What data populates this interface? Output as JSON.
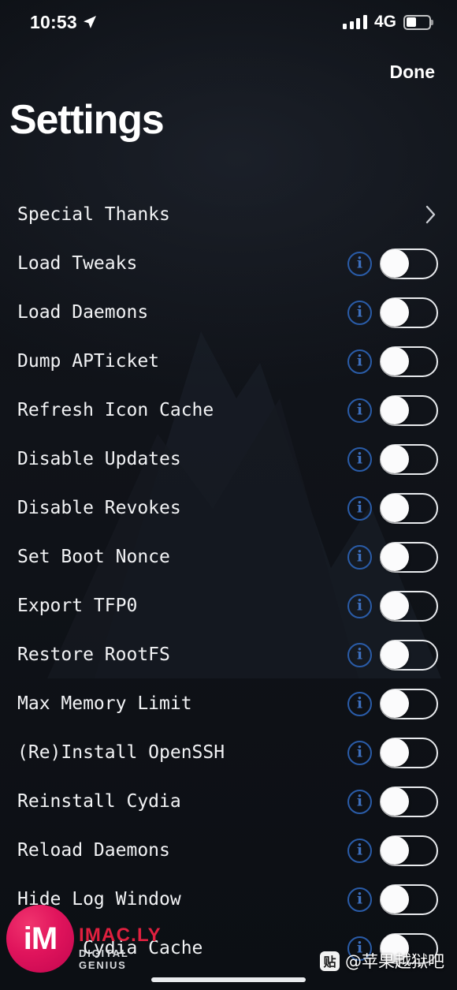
{
  "status_bar": {
    "time": "10:53",
    "location_icon": "location-arrow-icon",
    "signal_icon": "cellular-signal-icon",
    "signal_bars_filled": 4,
    "carrier": "4G",
    "battery_icon": "battery-icon",
    "battery_percent": 40
  },
  "nav": {
    "done_label": "Done"
  },
  "header": {
    "title": "Settings"
  },
  "list": {
    "rows": [
      {
        "label": "Special Thanks",
        "type": "disclosure",
        "accessory": "chevron-right-icon"
      },
      {
        "label": "Load Tweaks",
        "type": "toggle",
        "info": "i",
        "enabled": false
      },
      {
        "label": "Load Daemons",
        "type": "toggle",
        "info": "i",
        "enabled": false
      },
      {
        "label": "Dump APTicket",
        "type": "toggle",
        "info": "i",
        "enabled": false
      },
      {
        "label": "Refresh Icon Cache",
        "type": "toggle",
        "info": "i",
        "enabled": false
      },
      {
        "label": "Disable Updates",
        "type": "toggle",
        "info": "i",
        "enabled": false
      },
      {
        "label": "Disable Revokes",
        "type": "toggle",
        "info": "i",
        "enabled": false
      },
      {
        "label": "Set Boot Nonce",
        "type": "toggle",
        "info": "i",
        "enabled": false
      },
      {
        "label": "Export TFP0",
        "type": "toggle",
        "info": "i",
        "enabled": false
      },
      {
        "label": "Restore RootFS",
        "type": "toggle",
        "info": "i",
        "enabled": false
      },
      {
        "label": "Max Memory Limit",
        "type": "toggle",
        "info": "i",
        "enabled": false
      },
      {
        "label": "(Re)Install OpenSSH",
        "type": "toggle",
        "info": "i",
        "enabled": false
      },
      {
        "label": "Reinstall Cydia",
        "type": "toggle",
        "info": "i",
        "enabled": false
      },
      {
        "label": "Reload Daemons",
        "type": "toggle",
        "info": "i",
        "enabled": false
      },
      {
        "label": "Hide Log Window",
        "type": "toggle",
        "info": "i",
        "enabled": false
      },
      {
        "label": "Reset Cydia Cache",
        "type": "toggle",
        "info": "i",
        "enabled": false
      }
    ]
  },
  "watermarks": {
    "imacly_badge": "iM",
    "imacly_main": "IMAC.LY",
    "imacly_sub": "DIGITAL GENIUS",
    "tieba_icon": "贴",
    "tieba_text": "@苹果越狱吧"
  },
  "colors": {
    "background": "#0e1116",
    "text_primary": "#f2f3f5",
    "info_blue": "#3d6fbd",
    "info_border": "#2a5ca8",
    "toggle_track": "#e9ebee",
    "toggle_knob": "#fbfbfc",
    "watermark_red": "#e0203f"
  }
}
